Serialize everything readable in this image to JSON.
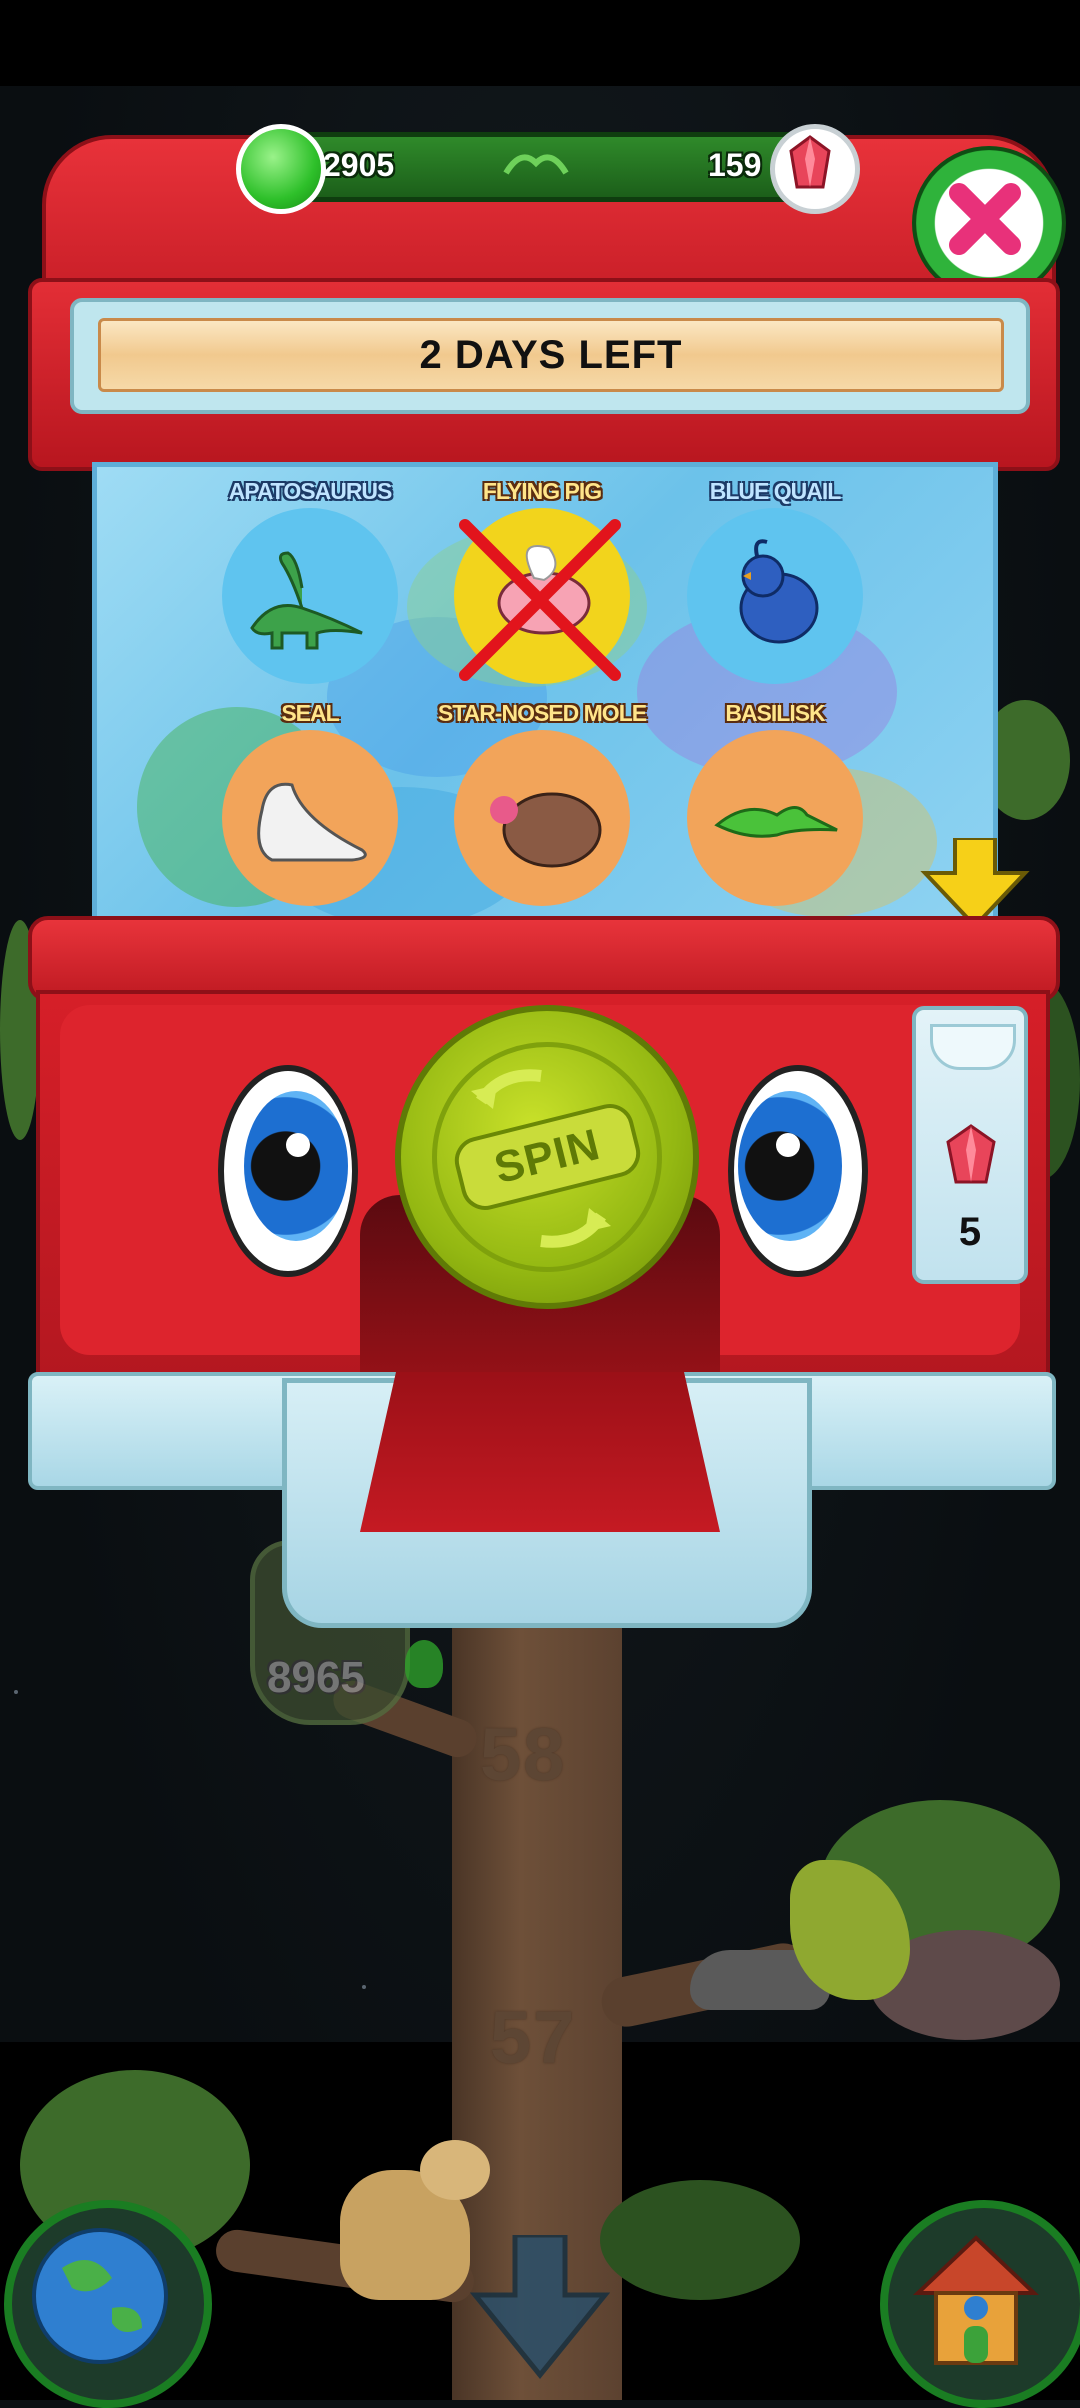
{
  "hud": {
    "green_gems": "2905",
    "red_gems": "159"
  },
  "banner": {
    "text": "2 DAYS LEFT"
  },
  "prizes": [
    {
      "label": "APATOSAURUS",
      "color": "#5fc4ef",
      "crossed": false,
      "icon": "apatosaurus-icon"
    },
    {
      "label": "FLYING PIG",
      "color": "#f2d41c",
      "crossed": true,
      "icon": "flying-pig-icon"
    },
    {
      "label": "BLUE QUAIL",
      "color": "#5fc4ef",
      "crossed": false,
      "icon": "blue-quail-icon"
    },
    {
      "label": "SEAL",
      "color": "#f2a45a",
      "crossed": false,
      "icon": "seal-icon"
    },
    {
      "label": "STAR-NOSED MOLE",
      "color": "#f2a45a",
      "crossed": false,
      "icon": "star-nosed-mole-icon"
    },
    {
      "label": "BASILISK",
      "color": "#f2a45a",
      "crossed": false,
      "icon": "basilisk-icon"
    }
  ],
  "spin_button": {
    "label": "SPIN"
  },
  "cost": {
    "value": "5",
    "icon": "red-gem-icon"
  },
  "tree": {
    "level_upper": "58",
    "level_lower": "57",
    "badge_value": "8965"
  },
  "nav": {
    "left_icon": "globe-icon",
    "center_icon": "down-arrow-icon",
    "right_icon": "house-icon"
  },
  "colors": {
    "machine_red": "#d61f28",
    "spin_green": "#a8c81a",
    "hud_green": "#2f8a2a"
  }
}
